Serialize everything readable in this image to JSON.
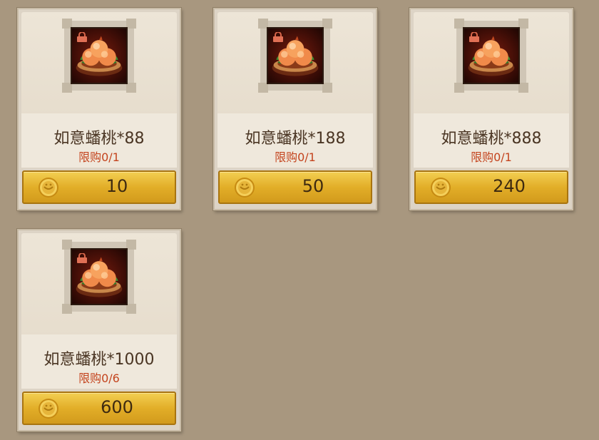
{
  "shop": {
    "items": [
      {
        "name": "如意蟠桃*88",
        "limit": "限购0/1",
        "price": "10"
      },
      {
        "name": "如意蟠桃*188",
        "limit": "限购0/1",
        "price": "50"
      },
      {
        "name": "如意蟠桃*888",
        "limit": "限购0/1",
        "price": "240"
      },
      {
        "name": "如意蟠桃*1000",
        "limit": "限购0/6",
        "price": "600"
      }
    ]
  },
  "icons": {
    "item": "peach-basket-icon",
    "lock": "lock-icon",
    "currency": "gold-coin-icon"
  },
  "colors": {
    "background": "#a8977f",
    "limit_text": "#c4441e",
    "button_gold": "#e2ae28"
  }
}
